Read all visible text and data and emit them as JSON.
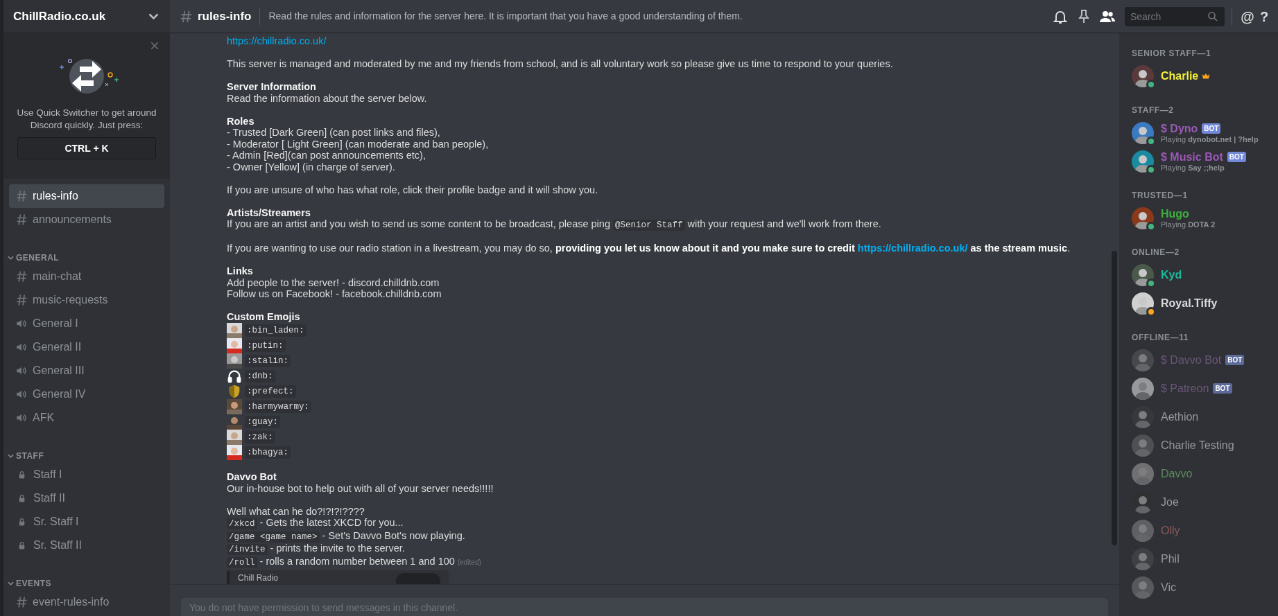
{
  "server": {
    "name": "ChillRadio.co.uk"
  },
  "quick_switcher": {
    "text": "Use Quick Switcher to get around Discord quickly. Just press:",
    "shortcut": "CTRL + K"
  },
  "channel_groups": [
    {
      "channels": [
        {
          "kind": "text",
          "name": "rules-info",
          "selected": true
        },
        {
          "kind": "text",
          "name": "announcements",
          "selected": false
        }
      ]
    },
    {
      "title": "GENERAL",
      "channels": [
        {
          "kind": "text",
          "name": "main-chat",
          "selected": false
        },
        {
          "kind": "text",
          "name": "music-requests",
          "selected": false
        },
        {
          "kind": "voice",
          "name": "General I",
          "selected": false
        },
        {
          "kind": "voice",
          "name": "General II",
          "selected": false
        },
        {
          "kind": "voice",
          "name": "General III",
          "selected": false
        },
        {
          "kind": "voice",
          "name": "General IV",
          "selected": false
        },
        {
          "kind": "voice",
          "name": "AFK",
          "selected": false
        }
      ]
    },
    {
      "title": "STAFF",
      "channels": [
        {
          "kind": "locked",
          "name": "Staff I",
          "selected": false
        },
        {
          "kind": "locked",
          "name": "Staff II",
          "selected": false
        },
        {
          "kind": "locked",
          "name": "Sr. Staff I",
          "selected": false
        },
        {
          "kind": "locked",
          "name": "Sr. Staff II",
          "selected": false
        }
      ]
    },
    {
      "title": "EVENTS",
      "channels": [
        {
          "kind": "text",
          "name": "event-rules-info",
          "selected": false
        }
      ]
    }
  ],
  "channel_header": {
    "name": "rules-info",
    "topic": "Read the rules and information for the server here. It is important that you have a good understanding of them."
  },
  "search": {
    "placeholder": "Search"
  },
  "toolbar_glyphs": [
    "@",
    "?"
  ],
  "message": {
    "blocks": [
      {
        "kind": "paragraph",
        "lines": [
          {
            "kind": "link",
            "text": "https://chillradio.co.uk/"
          }
        ]
      },
      {
        "kind": "paragraph",
        "lines": [
          {
            "kind": "text",
            "text": "This server is managed and moderated by me and my friends from school, and is all voluntary work so please give us time to respond to your queries."
          }
        ]
      },
      {
        "kind": "paragraph",
        "lines": [
          {
            "kind": "heading",
            "text": "Server Information"
          },
          {
            "kind": "text",
            "text": "Read the information about the server below."
          }
        ]
      },
      {
        "kind": "paragraph",
        "lines": [
          {
            "kind": "heading",
            "text": "Roles"
          },
          {
            "kind": "text",
            "text": "- Trusted [Dark Green] (can post links and files),"
          },
          {
            "kind": "text",
            "text": "- Moderator [ Light Green] (can moderate and ban people),"
          },
          {
            "kind": "text",
            "text": "- Admin [Red](can post announcements etc),"
          },
          {
            "kind": "text",
            "text": "- Owner [Yellow] (in charge of server)."
          }
        ]
      },
      {
        "kind": "paragraph",
        "lines": [
          {
            "kind": "text",
            "text": "If you are unsure of who has what role, click their profile badge and it will show you."
          }
        ]
      },
      {
        "kind": "paragraph",
        "lines": [
          {
            "kind": "heading",
            "text": "Artists/Streamers"
          },
          {
            "kind": "mixed",
            "segments": [
              {
                "kind": "text",
                "text": "If you are an artist and you wish to send us some content to be broadcast, please ping "
              },
              {
                "kind": "code",
                "text": "@Senior Staff"
              },
              {
                "kind": "text",
                "text": " with your request and we'll work from there."
              }
            ]
          }
        ]
      },
      {
        "kind": "paragraph",
        "lines": [
          {
            "kind": "mixed",
            "segments": [
              {
                "kind": "text",
                "text": "If you are wanting to use our radio station in a livestream, you may do so, "
              },
              {
                "kind": "bold",
                "text": "providing you let us know about it and you make sure to credit "
              },
              {
                "kind": "bold_link",
                "text": "https://chillradio.co.uk/"
              },
              {
                "kind": "bold",
                "text": " as the stream music"
              },
              {
                "kind": "text",
                "text": "."
              }
            ]
          }
        ]
      },
      {
        "kind": "paragraph",
        "lines": [
          {
            "kind": "heading",
            "text": "Links"
          },
          {
            "kind": "text",
            "text": "Add people to the server! - discord.chilldnb.com"
          },
          {
            "kind": "text",
            "text": "Follow us on Facebook! - facebook.chilldnb.com"
          }
        ]
      },
      {
        "kind": "paragraph",
        "lines": [
          {
            "kind": "heading",
            "text": "Custom Emojis"
          },
          {
            "kind": "picture_emoji",
            "code": ":bin_laden:"
          },
          {
            "kind": "picture_emoji",
            "code": ":putin:"
          },
          {
            "kind": "picture_emoji",
            "code": ":stalin:"
          },
          {
            "kind": "headphones_emoji",
            "code": ":dnb:"
          },
          {
            "kind": "shield_emoji",
            "code": ":prefect:"
          },
          {
            "kind": "picture_emoji",
            "code": ":harmywarmy:"
          },
          {
            "kind": "picture_emoji",
            "code": ":guay:"
          },
          {
            "kind": "picture_emoji",
            "code": ":zak:"
          },
          {
            "kind": "picture_emoji",
            "code": ":bhagya:"
          }
        ]
      },
      {
        "kind": "blank"
      },
      {
        "kind": "paragraph",
        "lines": [
          {
            "kind": "heading",
            "text": "Davvo Bot"
          },
          {
            "kind": "text",
            "text": "Our in-house bot to help out with all of your server needs!!!!!"
          }
        ]
      },
      {
        "kind": "paragraph",
        "lines": [
          {
            "kind": "text",
            "text": "Well what can he do?!?!?!????"
          },
          {
            "kind": "mixed",
            "segments": [
              {
                "kind": "code",
                "text": "/xkcd"
              },
              {
                "kind": "text",
                "text": " - Gets the latest XKCD for you..."
              }
            ]
          },
          {
            "kind": "mixed",
            "segments": [
              {
                "kind": "code",
                "text": "/game <game name>"
              },
              {
                "kind": "text",
                "text": " - Set's Davvo Bot's now playing."
              }
            ]
          },
          {
            "kind": "mixed",
            "segments": [
              {
                "kind": "code",
                "text": "/invite"
              },
              {
                "kind": "text",
                "text": " - prints the invite to the server."
              }
            ]
          },
          {
            "kind": "mixed",
            "segments": [
              {
                "kind": "code",
                "text": "/roll"
              },
              {
                "kind": "text",
                "text": " - rolls a random number between 1 and 100 "
              },
              {
                "kind": "edited",
                "text": "(edited)"
              }
            ]
          }
        ]
      }
    ],
    "embed": {
      "title": "Chill Radio"
    }
  },
  "composer": {
    "placeholder": "You do not have permission to send messages in this channel."
  },
  "member_groups": [
    {
      "title": "SENIOR STAFF—1",
      "members": [
        {
          "name": "Charlie",
          "color": "#f3ef3a",
          "online": true,
          "idle": false,
          "owner": true
        }
      ]
    },
    {
      "title": "STAFF—2",
      "members": [
        {
          "name": "$ Dyno",
          "color": "#9b59b6",
          "online": true,
          "idle": false,
          "owner": false,
          "badge": "BOT",
          "activity": "Playing **dynobot.net | ?help**"
        },
        {
          "name": "$ Music Bot",
          "color": "#9b59b6",
          "online": true,
          "idle": false,
          "owner": false,
          "badge": "BOT",
          "activity": "Playing **Say ;;help**"
        }
      ]
    },
    {
      "title": "TRUSTED—1",
      "members": [
        {
          "name": "Hugo",
          "color": "#3fb03f",
          "online": true,
          "idle": false,
          "owner": false,
          "activity": "Playing **DOTA 2**"
        }
      ]
    },
    {
      "title": "ONLINE—2",
      "members": [
        {
          "name": "Kyd",
          "color": "#1abc9c",
          "online": true,
          "idle": false,
          "owner": false
        },
        {
          "name": "Royal.Tiffy",
          "color": "#dcddde",
          "online": true,
          "idle": true,
          "owner": false
        }
      ]
    },
    {
      "title": "OFFLINE—11",
      "members": [
        {
          "name": "$ Davvo Bot",
          "color": "#6c5679",
          "online": false,
          "owner": false,
          "badge": "BOT"
        },
        {
          "name": "$ Patreon",
          "color": "#6c5679",
          "online": false,
          "owner": false,
          "badge": "BOT"
        },
        {
          "name": "Aethion",
          "color": "#96989d",
          "online": false,
          "owner": false
        },
        {
          "name": "Charlie Testing",
          "color": "#96989d",
          "online": false,
          "owner": false
        },
        {
          "name": "Davvo",
          "color": "#5c8a5c",
          "online": false,
          "owner": false
        },
        {
          "name": "Joe",
          "color": "#96989d",
          "online": false,
          "owner": false
        },
        {
          "name": "Olly",
          "color": "#8c5a5a",
          "online": false,
          "owner": false
        },
        {
          "name": "Phil",
          "color": "#96989d",
          "online": false,
          "owner": false
        },
        {
          "name": "Vic",
          "color": "#96989d",
          "online": false,
          "owner": false
        }
      ]
    }
  ]
}
